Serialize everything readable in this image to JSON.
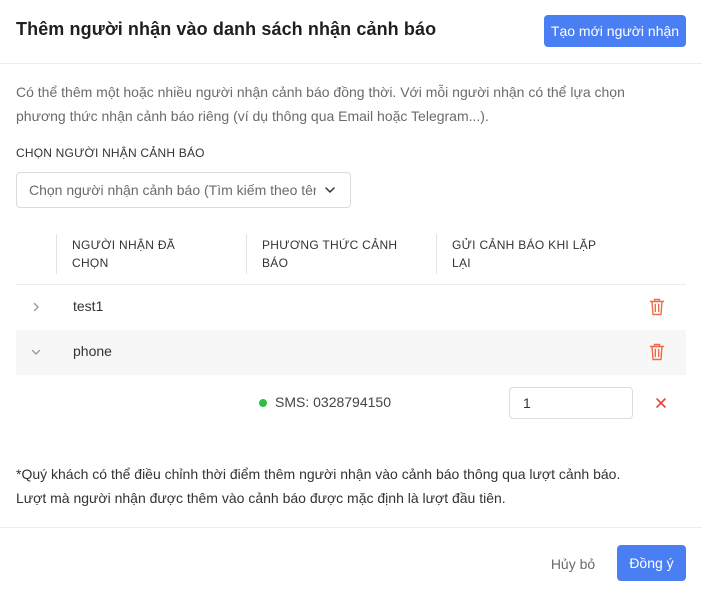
{
  "dialog": {
    "title": "Thêm người nhận vào danh sách nhận cảnh báo",
    "create_button": "Tạo mới người nhận",
    "description": "Có thể thêm một hoặc nhiều người nhận cảnh báo đồng thời. Với mỗi người nhận có thể lựa chọn phương thức nhận cảnh báo riêng (ví dụ thông qua Email hoặc Telegram...)."
  },
  "recipient_select": {
    "label": "CHỌN NGƯỜI NHẬN CẢNH BÁO",
    "placeholder": "Chọn người nhận cảnh báo (Tìm kiếm theo tên",
    "icon": "chevron-down-icon"
  },
  "table": {
    "columns": [
      "NGƯỜI NHẬN ĐÃ CHỌN",
      "PHƯƠNG THỨC CẢNH BÁO",
      "GỬI CẢNH BÁO KHI LẶP LẠI"
    ],
    "rows": [
      {
        "name": "test1",
        "expanded": false
      },
      {
        "name": "phone",
        "expanded": true,
        "methods": [
          {
            "label": "SMS: 0328794150",
            "status_color": "#2fbd45",
            "repeat": "1"
          }
        ]
      }
    ],
    "icons": {
      "expand_collapsed": "chevron-right-icon",
      "expand_open": "chevron-down-icon",
      "delete": "trash-icon",
      "remove": "close-icon"
    },
    "colors": {
      "delete": "#f06a48",
      "remove": "#e8463a"
    }
  },
  "note": {
    "line1": "*Quý khách có thể điều chỉnh thời điểm thêm người nhận vào cảnh báo thông qua lượt cảnh báo.",
    "line2": "Lượt mà người nhận được thêm vào cảnh báo được mặc định là lượt đầu tiên."
  },
  "footer": {
    "cancel": "Hủy bỏ",
    "confirm": "Đồng ý"
  },
  "colors": {
    "primary": "#4a7ff3"
  }
}
